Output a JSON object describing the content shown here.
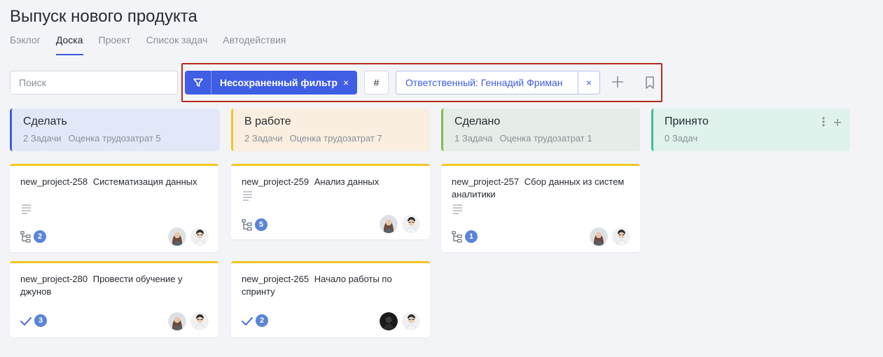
{
  "page": {
    "title": "Выпуск нового продукта"
  },
  "tabs": [
    {
      "label": "Бэклог",
      "active": false
    },
    {
      "label": "Доска",
      "active": true
    },
    {
      "label": "Проект",
      "active": false
    },
    {
      "label": "Список задач",
      "active": false
    },
    {
      "label": "Автодействия",
      "active": false
    }
  ],
  "toolbar": {
    "search_placeholder": "Поиск",
    "filter_label": "Несохраненный фильтр",
    "filter_close": "×",
    "hash_label": "#",
    "chip_label": "Ответственный: Геннадий Фриман",
    "chip_close": "×"
  },
  "columns": [
    {
      "title": "Сделать",
      "count": "2 Задачи",
      "estimate": "Оценка трудозатрат 5",
      "bg": "#e3e8f8",
      "accent": "#3f5ee3"
    },
    {
      "title": "В работе",
      "count": "2 Задачи",
      "estimate": "Оценка трудозатрат 7",
      "bg": "#f9eedf",
      "accent": "#f3c623"
    },
    {
      "title": "Сделано",
      "count": "1 Задача",
      "estimate": "Оценка трудозатрат 1",
      "bg": "#e6ece6",
      "accent": "#7cc04b"
    },
    {
      "title": "Принято",
      "count": "0 Задач",
      "estimate": "",
      "bg": "#dff2ec",
      "accent": "#3cc08a"
    }
  ],
  "cards": [
    {
      "key": "new_project-258",
      "title": "Систематизация данных",
      "count": "2",
      "type": "subtasks"
    },
    {
      "key": "new_project-280",
      "title": "Провести обучение у джунов",
      "count": "3",
      "type": "check"
    },
    {
      "key": "new_project-259",
      "title": "Анализ данных",
      "count": "5",
      "type": "subtasks"
    },
    {
      "key": "new_project-265",
      "title": "Начало работы по спринту",
      "count": "2",
      "type": "check"
    },
    {
      "key": "new_project-257",
      "title": "Сбор данных из систем аналитики",
      "count": "1",
      "type": "subtasks"
    }
  ],
  "icons": {
    "funnel": "funnel-icon",
    "plus": "plus-icon",
    "bookmark": "bookmark-icon",
    "description": "description-icon",
    "subtasks": "subtasks-icon",
    "check": "check-icon",
    "more": "more-vertical-icon"
  }
}
